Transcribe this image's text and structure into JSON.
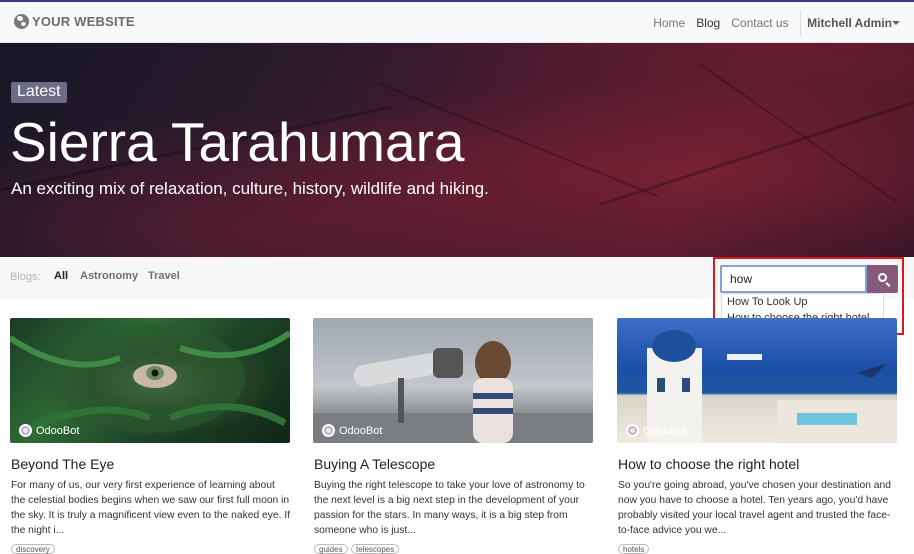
{
  "navbar": {
    "logo_text": "YOUR WEBSITE",
    "links": [
      "Home",
      "Blog",
      "Contact us"
    ],
    "user": "Mitchell Admin"
  },
  "hero": {
    "badge": "Latest",
    "title": "Sierra Tarahumara",
    "subtitle": "An exciting mix of relaxation, culture, history, wildlife and hiking."
  },
  "filters": {
    "label": "Blogs:",
    "tabs": [
      "All",
      "Astronomy",
      "Travel"
    ],
    "active": "All"
  },
  "search": {
    "value": "how",
    "suggestions": [
      "How To Look Up",
      "How to choose the right hotel"
    ]
  },
  "posts": [
    {
      "author": "OdooBot",
      "title": "Beyond The Eye",
      "excerpt": "For many of us, our very first experience of learning about the celestial bodies begins when we saw our first full moon in the sky. It is truly a magnificent view even to the naked eye. If the night i...",
      "tags": [
        "discovery"
      ]
    },
    {
      "author": "OdooBot",
      "title": "Buying A Telescope",
      "excerpt": "Buying the right telescope to take your love of astronomy to the next level is a big next step in the development of your passion for the stars. In many ways, it is a big step from someone who is just...",
      "tags": [
        "guides",
        "telescopes"
      ]
    },
    {
      "author": "OdooBot",
      "title": "How to choose the right hotel",
      "excerpt": "So you're going abroad, you've chosen your destination and now you have to choose a hotel. Ten years ago, you'd have probably visited your local travel agent and trusted the face-to-face advice you we...",
      "tags": [
        "hotels"
      ]
    }
  ],
  "colors": {
    "accent": "#875a7b",
    "highlight_border": "#d9191f"
  }
}
